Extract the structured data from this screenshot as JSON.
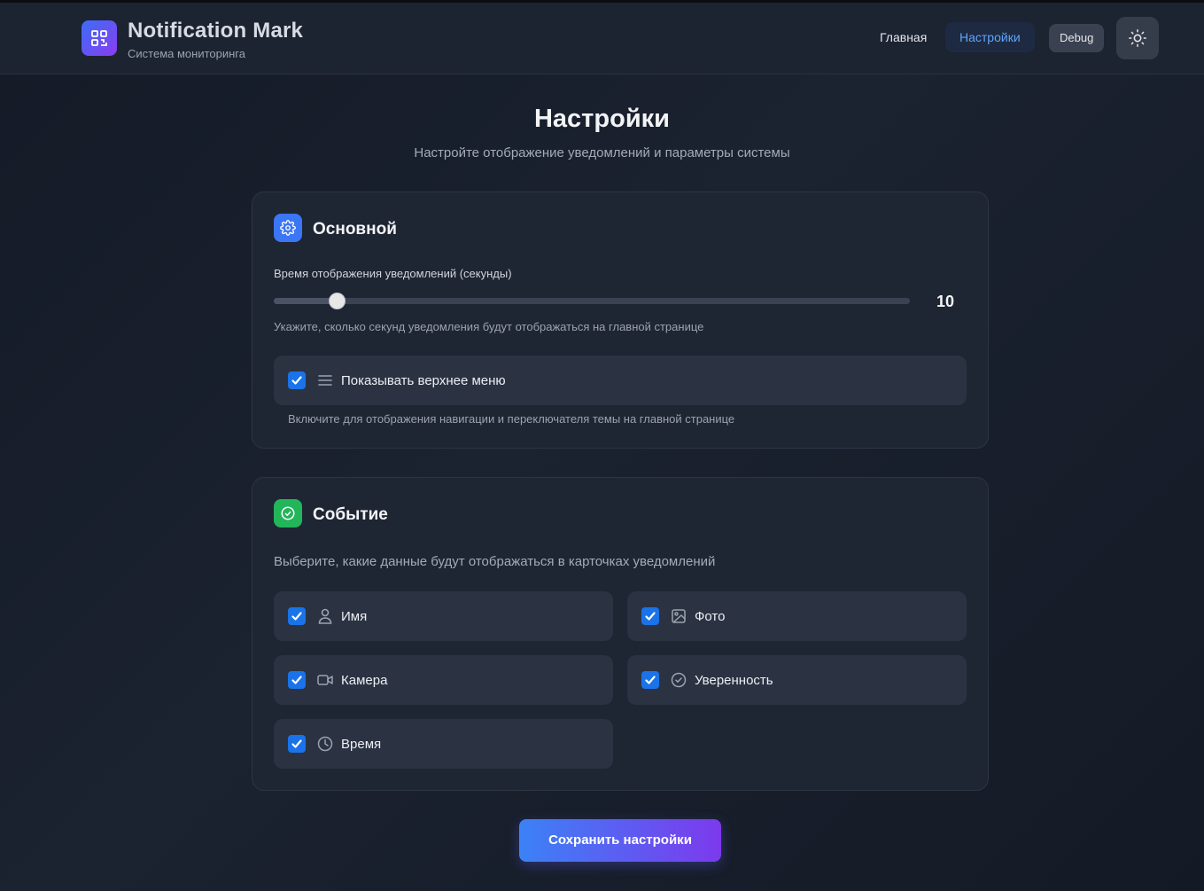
{
  "header": {
    "title": "Notification Mark",
    "subtitle": "Система мониторинга",
    "nav": {
      "home": "Главная",
      "settings": "Настройки",
      "debug": "Debug"
    },
    "theme_toggle_icon": "sun-icon",
    "logo_icon": "qr-grid-icon"
  },
  "page": {
    "title": "Настройки",
    "subtitle": "Настройте отображение уведомлений и параметры системы"
  },
  "general": {
    "title": "Основной",
    "icon": "gear-icon",
    "duration_label": "Время отображения уведомлений (секунды)",
    "duration_value": "10",
    "duration_fraction": 0.1,
    "duration_hint": "Укажите, сколько секунд уведомления будут отображаться на главной странице",
    "show_menu": {
      "label": "Показывать верхнее меню",
      "checked": true,
      "icon": "menu-lines-icon",
      "hint": "Включите для отображения навигации и переключателя темы на главной странице"
    }
  },
  "event": {
    "title": "Событие",
    "icon": "check-circle-icon",
    "description": "Выберите, какие данные будут отображаться в карточках уведомлений",
    "options": [
      {
        "label": "Имя",
        "checked": true,
        "icon": "user-icon"
      },
      {
        "label": "Фото",
        "checked": true,
        "icon": "image-icon"
      },
      {
        "label": "Камера",
        "checked": true,
        "icon": "video-camera-icon"
      },
      {
        "label": "Уверенность",
        "checked": true,
        "icon": "check-circle-icon"
      },
      {
        "label": "Время",
        "checked": true,
        "icon": "clock-icon"
      }
    ]
  },
  "save_button": "Сохранить настройки",
  "colors": {
    "accent_blue": "#3b82f6",
    "accent_purple": "#7c3aed",
    "checkbox": "#1a73e8",
    "active_nav": "#60a5fa",
    "event_icon_bg": "#22b55a"
  }
}
